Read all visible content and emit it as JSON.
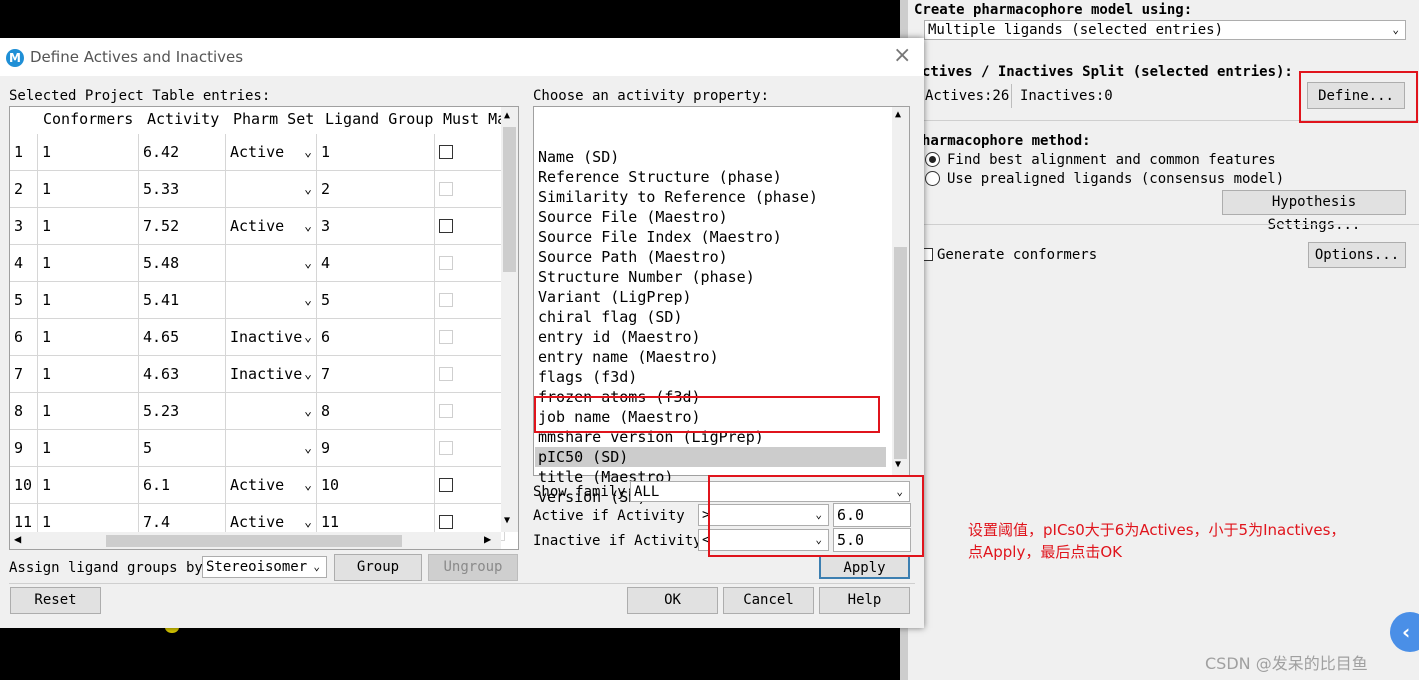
{
  "right_panel": {
    "create_label": "Create pharmacophore model using:",
    "create_value": "Multiple ligands (selected entries)",
    "split_label": "ctives / Inactives Split (selected entries):",
    "actives": "Actives:26",
    "inactives": "Inactives:0",
    "define_button": "Define...",
    "method_label": "harmacophore method:",
    "radio_best": "Find best alignment and common features",
    "radio_prealigned": "Use prealigned ligands (consensus model)",
    "hypothesis_button": "Hypothesis Settings...",
    "generate_conformers": "Generate conformers",
    "options_button": "Options...",
    "watermark": "CSDN @发呆的比目鱼",
    "collapse_icon": "chevron-left-icon"
  },
  "dialog": {
    "title": "Define Actives and Inactives",
    "app_icon": "M",
    "table_label": "Selected Project Table entries:",
    "columns": [
      "Conformers",
      "Activity",
      "Pharm Set",
      "Ligand Group",
      "Must Ma"
    ],
    "rows": [
      {
        "n": "1",
        "conf": "1",
        "act": "6.42",
        "set": "Active",
        "grp": "1",
        "must": "enabled"
      },
      {
        "n": "2",
        "conf": "1",
        "act": "5.33",
        "set": "",
        "grp": "2",
        "must": "disabled"
      },
      {
        "n": "3",
        "conf": "1",
        "act": "7.52",
        "set": "Active",
        "grp": "3",
        "must": "enabled"
      },
      {
        "n": "4",
        "conf": "1",
        "act": "5.48",
        "set": "",
        "grp": "4",
        "must": "disabled"
      },
      {
        "n": "5",
        "conf": "1",
        "act": "5.41",
        "set": "",
        "grp": "5",
        "must": "disabled"
      },
      {
        "n": "6",
        "conf": "1",
        "act": "4.65",
        "set": "Inactive",
        "grp": "6",
        "must": "disabled"
      },
      {
        "n": "7",
        "conf": "1",
        "act": "4.63",
        "set": "Inactive",
        "grp": "7",
        "must": "disabled"
      },
      {
        "n": "8",
        "conf": "1",
        "act": "5.23",
        "set": "",
        "grp": "8",
        "must": "disabled"
      },
      {
        "n": "9",
        "conf": "1",
        "act": "5",
        "set": "",
        "grp": "9",
        "must": "disabled"
      },
      {
        "n": "10",
        "conf": "1",
        "act": "6.1",
        "set": "Active",
        "grp": "10",
        "must": "enabled"
      },
      {
        "n": "11",
        "conf": "1",
        "act": "7.4",
        "set": "Active",
        "grp": "11",
        "must": "enabled"
      }
    ],
    "assign_label": "Assign ligand groups by:",
    "assign_value": "Stereoisomer",
    "group_button": "Group",
    "ungroup_button": "Ungroup",
    "property_label": "Choose an activity property:",
    "properties": [
      "Name (SD)",
      "Reference Structure (phase)",
      "Similarity to Reference (phase)",
      "Source File (Maestro)",
      "Source File Index (Maestro)",
      "Source Path (Maestro)",
      "Structure Number (phase)",
      "Variant (LigPrep)",
      "chiral flag (SD)",
      "entry id (Maestro)",
      "entry name (Maestro)",
      "flags (f3d)",
      "frozen atoms (f3d)",
      "job name (Maestro)",
      "mmshare version (LigPrep)",
      "pIC50 (SD)",
      "title (Maestro)",
      "version (SD)"
    ],
    "selected_property": "pIC50 (SD)",
    "show_family_label": "Show family:",
    "show_family_value": "ALL",
    "active_if_label": "Active if Activity",
    "active_op": ">",
    "active_value": "6.0",
    "inactive_if_label": "Inactive if Activity",
    "inactive_op": "<",
    "inactive_value": "5.0",
    "apply_button": "Apply",
    "reset_button": "Reset",
    "ok_button": "OK",
    "cancel_button": "Cancel",
    "help_button": "Help"
  },
  "annotation": {
    "line1": "设置阈值，pICs0大于6为Actives，小于5为Inactives，",
    "line2": "点Apply，最后点击OK",
    "color": "#e0141c"
  }
}
